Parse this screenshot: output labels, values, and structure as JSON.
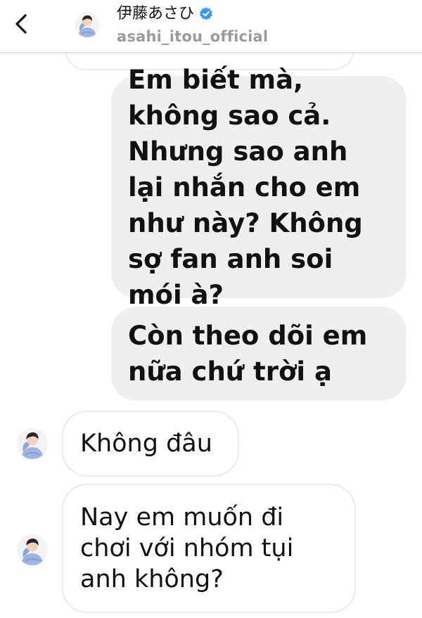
{
  "header": {
    "display_name": "伊藤あさひ",
    "username": "asahi_itou_official",
    "verified": true,
    "back_icon": "chevron-left-icon",
    "verified_icon": "verified-badge-icon",
    "accent_color": "#3897f0"
  },
  "messages": [
    {
      "direction": "outgoing",
      "text": "Em biết mà, không sao cả. Nhưng sao anh lại nhắn cho em như này? Không sợ fan anh soi mói à?"
    },
    {
      "direction": "outgoing",
      "text": "Còn theo dõi em nữa chứ trời ạ"
    },
    {
      "direction": "incoming",
      "text": "Không đâu"
    },
    {
      "direction": "incoming",
      "text": "Nay em muốn đi chơi với nhóm tụi anh không?"
    }
  ],
  "colors": {
    "outgoing_bubble": "#efefef",
    "incoming_border": "#ececec",
    "text": "#111111",
    "username": "#9a9a9a"
  }
}
